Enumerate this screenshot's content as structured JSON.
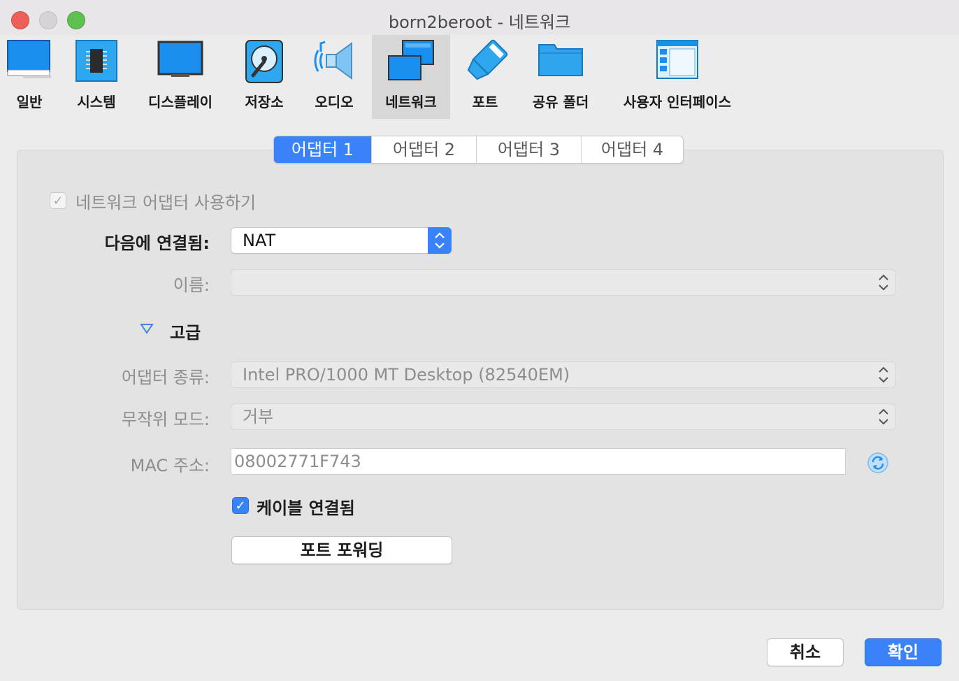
{
  "window": {
    "title": "born2beroot - 네트워크"
  },
  "toolbar": {
    "items": [
      {
        "label": "일반",
        "icon": "general-icon"
      },
      {
        "label": "시스템",
        "icon": "chip-icon"
      },
      {
        "label": "디스플레이",
        "icon": "display-icon"
      },
      {
        "label": "저장소",
        "icon": "storage-icon"
      },
      {
        "label": "오디오",
        "icon": "speaker-icon"
      },
      {
        "label": "네트워크",
        "icon": "network-icon",
        "selected": true
      },
      {
        "label": "포트",
        "icon": "port-icon"
      },
      {
        "label": "공유 폴더",
        "icon": "folder-icon"
      },
      {
        "label": "사용자 인터페이스",
        "icon": "ui-icon"
      }
    ]
  },
  "tabs": [
    {
      "label": "어댑터 1",
      "selected": true
    },
    {
      "label": "어댑터 2"
    },
    {
      "label": "어댑터 3"
    },
    {
      "label": "어댑터 4"
    }
  ],
  "form": {
    "enable_adapter": {
      "label": "네트워크 어댑터 사용하기",
      "checked": true,
      "disabled": true
    },
    "attached_to": {
      "label": "다음에 연결됨:",
      "value": "NAT"
    },
    "name": {
      "label": "이름:",
      "value": ""
    },
    "advanced": {
      "label": "고급",
      "expanded": true
    },
    "adapter_type": {
      "label": "어댑터 종류:",
      "value": "Intel PRO/1000 MT Desktop (82540EM)"
    },
    "promiscuous": {
      "label": "무작위 모드:",
      "value": "거부"
    },
    "mac": {
      "label": "MAC 주소:",
      "value": "08002771F743"
    },
    "cable_connected": {
      "label": "케이블 연결됨",
      "checked": true
    },
    "port_forwarding": {
      "label": "포트 포워딩"
    }
  },
  "footer": {
    "cancel_label": "취소",
    "ok_label": "확인"
  },
  "colors": {
    "accent": "#3a82f7",
    "close": "#ee5f58",
    "zoom": "#5ec04f"
  }
}
